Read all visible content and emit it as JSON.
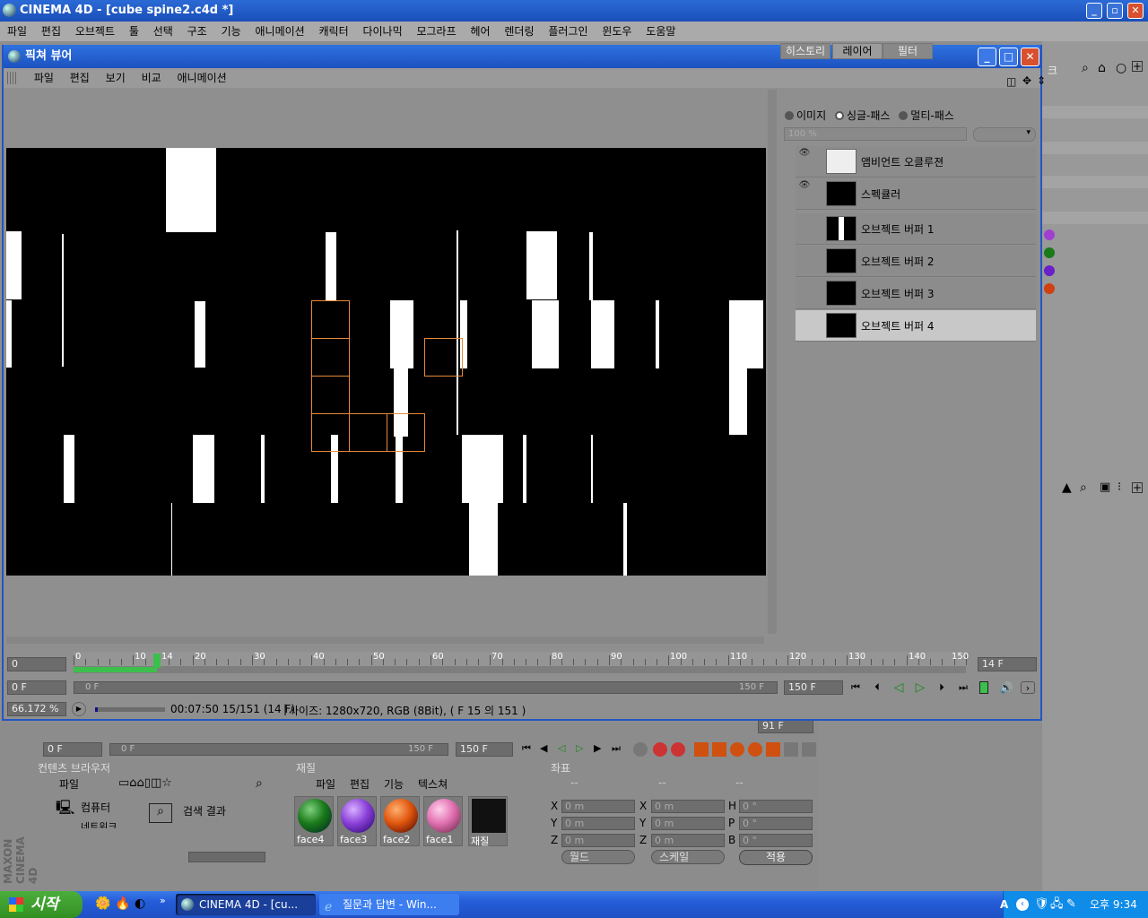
{
  "app": {
    "title": "CINEMA 4D - [cube spine2.c4d *]",
    "menu": [
      "파일",
      "편집",
      "오브젝트",
      "툴",
      "선택",
      "구조",
      "기능",
      "애니메이션",
      "캐릭터",
      "다이나믹",
      "모그라프",
      "헤어",
      "렌더링",
      "플러그인",
      "윈도우",
      "도움말"
    ]
  },
  "viewer": {
    "title": "픽쳐 뷰어",
    "menu": [
      "파일",
      "편집",
      "보기",
      "비교",
      "애니메이션"
    ],
    "tabs": [
      "히스토리",
      "레이어",
      "필터"
    ],
    "active_tab": "레이어",
    "radios": [
      "이미지",
      "싱글-패스",
      "멀티-패스"
    ],
    "selected_radio": "싱글-패스",
    "zoom_field": "100 %",
    "layers": [
      {
        "name": "앰비언트 오클루젼",
        "visible": true
      },
      {
        "name": "스펙큘러",
        "visible": true
      },
      {
        "name": "오브젝트 버퍼 1",
        "visible": false
      },
      {
        "name": "오브젝트 버퍼 2",
        "visible": false
      },
      {
        "name": "오브젝트 버퍼 3",
        "visible": false
      },
      {
        "name": "오브젝트 버퍼 4",
        "visible": false,
        "selected": true
      }
    ],
    "timeline": {
      "start_field": "0",
      "current_field": "14 F",
      "ticks": [
        "0",
        "10",
        "14",
        "20",
        "30",
        "40",
        "50",
        "60",
        "70",
        "80",
        "90",
        "100",
        "110",
        "120",
        "130",
        "140",
        "150"
      ],
      "current_frame": 14,
      "max_frame": 150,
      "range_start": "0 F",
      "range_slider_start": "0 F",
      "range_slider_end": "150 F",
      "end_field": "150 F"
    },
    "status": {
      "zoom": "66.172 %",
      "time": "00:07:50 15/151 (14 F)",
      "info": "사이즈: 1280x720, RGB (8Bit),  ( F 15 의 151 )"
    }
  },
  "background_app": {
    "timeline_field": "91 F",
    "start_field": "0 F",
    "slider_start": "0 F",
    "slider_end": "150 F",
    "end_field": "150 F",
    "content_browser": {
      "title": "컨텐츠 브라우저",
      "menu": [
        "파일"
      ],
      "tree": [
        "컴퓨터",
        "네트워크"
      ],
      "item": "검색 결과"
    },
    "materials": {
      "title": "재질",
      "menu": [
        "파일",
        "편집",
        "기능",
        "텍스쳐"
      ],
      "items": [
        {
          "name": "face4",
          "color": "#1a7a1a"
        },
        {
          "name": "face3",
          "color": "#8a40d8"
        },
        {
          "name": "face2",
          "color": "#e0560e"
        },
        {
          "name": "face1",
          "color": "#e070b0"
        },
        {
          "name": "재질",
          "color": "#111111"
        }
      ]
    },
    "coordinates": {
      "title": "좌표",
      "cols": [
        "--",
        "--",
        "--"
      ],
      "rows": [
        [
          "X",
          "0 m",
          "X",
          "0 m",
          "H",
          "0 °"
        ],
        [
          "Y",
          "0 m",
          "Y",
          "0 m",
          "P",
          "0 °"
        ],
        [
          "Z",
          "0 m",
          "Z",
          "0 m",
          "B",
          "0 °"
        ]
      ],
      "world": "월드",
      "scale": "스케일",
      "apply": "적용"
    },
    "brand": "MAXON CINEMA 4D",
    "right_panel_text": "크"
  },
  "taskbar": {
    "start": "시작",
    "tasks": [
      "CINEMA 4D - [cu...",
      "질문과 답변 - Win..."
    ],
    "clock": "오후 9:34",
    "ime": "A"
  }
}
